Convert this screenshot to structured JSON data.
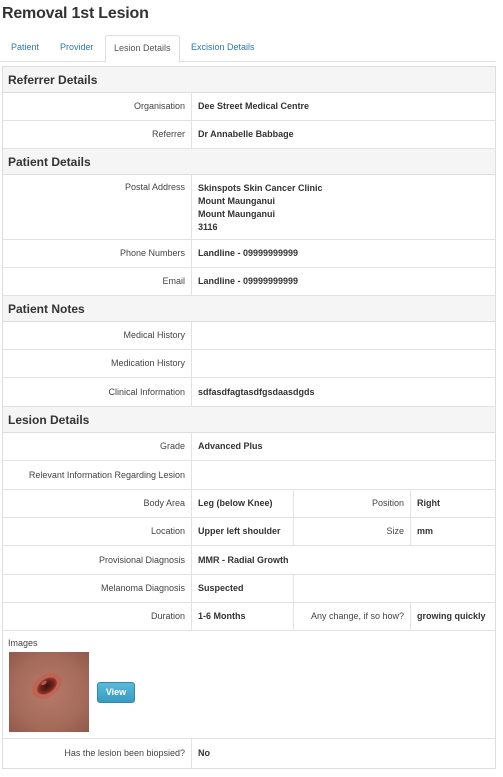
{
  "page": {
    "title": "Removal 1st Lesion"
  },
  "tabs": [
    {
      "label": "Patient"
    },
    {
      "label": "Provider"
    },
    {
      "label": "Lesion Details"
    },
    {
      "label": "Excision Details"
    }
  ],
  "referrer": {
    "heading": "Referrer Details",
    "organisation_label": "Organisation",
    "organisation": "Dee Street Medical Centre",
    "referrer_label": "Referrer",
    "referrer": "Dr Annabelle Babbage"
  },
  "patient": {
    "heading": "Patient Details",
    "postal_label": "Postal Address",
    "postal_lines": [
      "Skinspots Skin Cancer Clinic",
      "Mount Maunganui",
      "Mount Maunganui",
      "3116"
    ],
    "phone_label": "Phone Numbers",
    "phone": "Landline - 09999999999",
    "email_label": "Email",
    "email": "Landline - 09999999999"
  },
  "notes": {
    "heading": "Patient Notes",
    "medical_label": "Medical History",
    "medical": "",
    "medication_label": "Medication History",
    "medication": "",
    "clinical_label": "Clinical Information",
    "clinical": "sdfasdfagtasdfgsdaasdgds"
  },
  "lesion": {
    "heading": "Lesion Details",
    "grade_label": "Grade",
    "grade": "Advanced Plus",
    "relevant_label": "Relevant Information Regarding Lesion",
    "relevant": "",
    "body_area_label": "Body Area",
    "body_area": "Leg (below Knee)",
    "position_label": "Position",
    "position": "Right",
    "location_label": "Location",
    "location": "Upper left shoulder",
    "size_label": "Size",
    "size": "mm",
    "provisional_label": "Provisional Diagnosis",
    "provisional": "MMR - Radial Growth",
    "melanoma_label": "Melanoma Diagnosis",
    "melanoma": "Suspected",
    "duration_label": "Duration",
    "duration": "1-6 Months",
    "change_label": "Any change, if so how?",
    "change": "growing quickly",
    "images_label": "Images",
    "view_label": "View",
    "biopsied_label": "Has the lesion been biopsied?",
    "biopsied": "No"
  },
  "colors": {
    "link": "#2a7ab0",
    "button": "#3a9cc2"
  },
  "icons": {
    "thumbnail": "lesion-photo"
  }
}
